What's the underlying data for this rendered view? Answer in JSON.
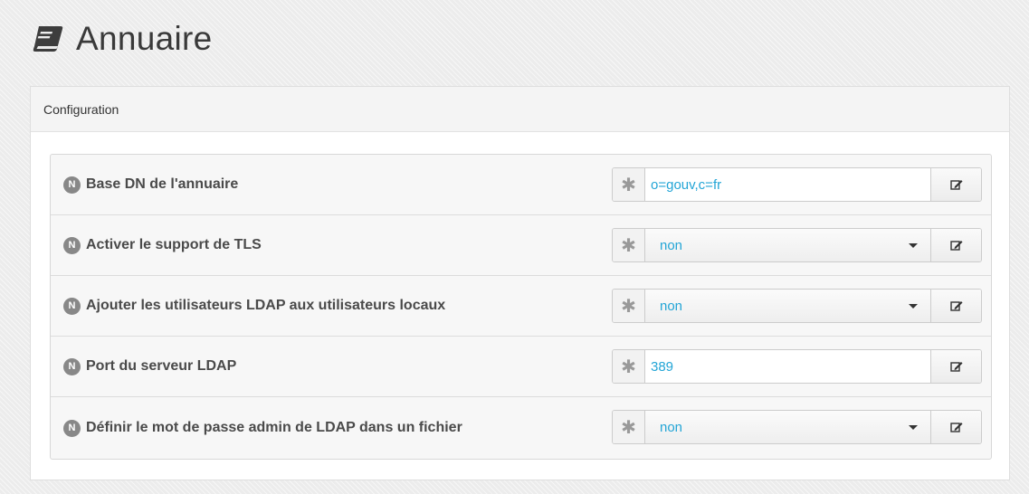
{
  "header": {
    "title": "Annuaire",
    "icon": "book-icon"
  },
  "panel": {
    "heading": "Configuration"
  },
  "colors": {
    "value_text": "#23a5d6",
    "badge": "#888888"
  },
  "rows": [
    {
      "badge": "N",
      "label": "Base DN de l'annuaire",
      "type": "text",
      "value": "o=gouv,c=fr",
      "required_marker": "✱"
    },
    {
      "badge": "N",
      "label": "Activer le support de TLS",
      "type": "select",
      "value": "non",
      "required_marker": "✱"
    },
    {
      "badge": "N",
      "label": "Ajouter les utilisateurs LDAP aux utilisateurs locaux",
      "type": "select",
      "value": "non",
      "required_marker": "✱"
    },
    {
      "badge": "N",
      "label": "Port du serveur LDAP",
      "type": "text",
      "value": "389",
      "required_marker": "✱"
    },
    {
      "badge": "N",
      "label": "Définir le mot de passe admin de LDAP dans un fichier",
      "type": "select",
      "value": "non",
      "required_marker": "✱"
    }
  ]
}
